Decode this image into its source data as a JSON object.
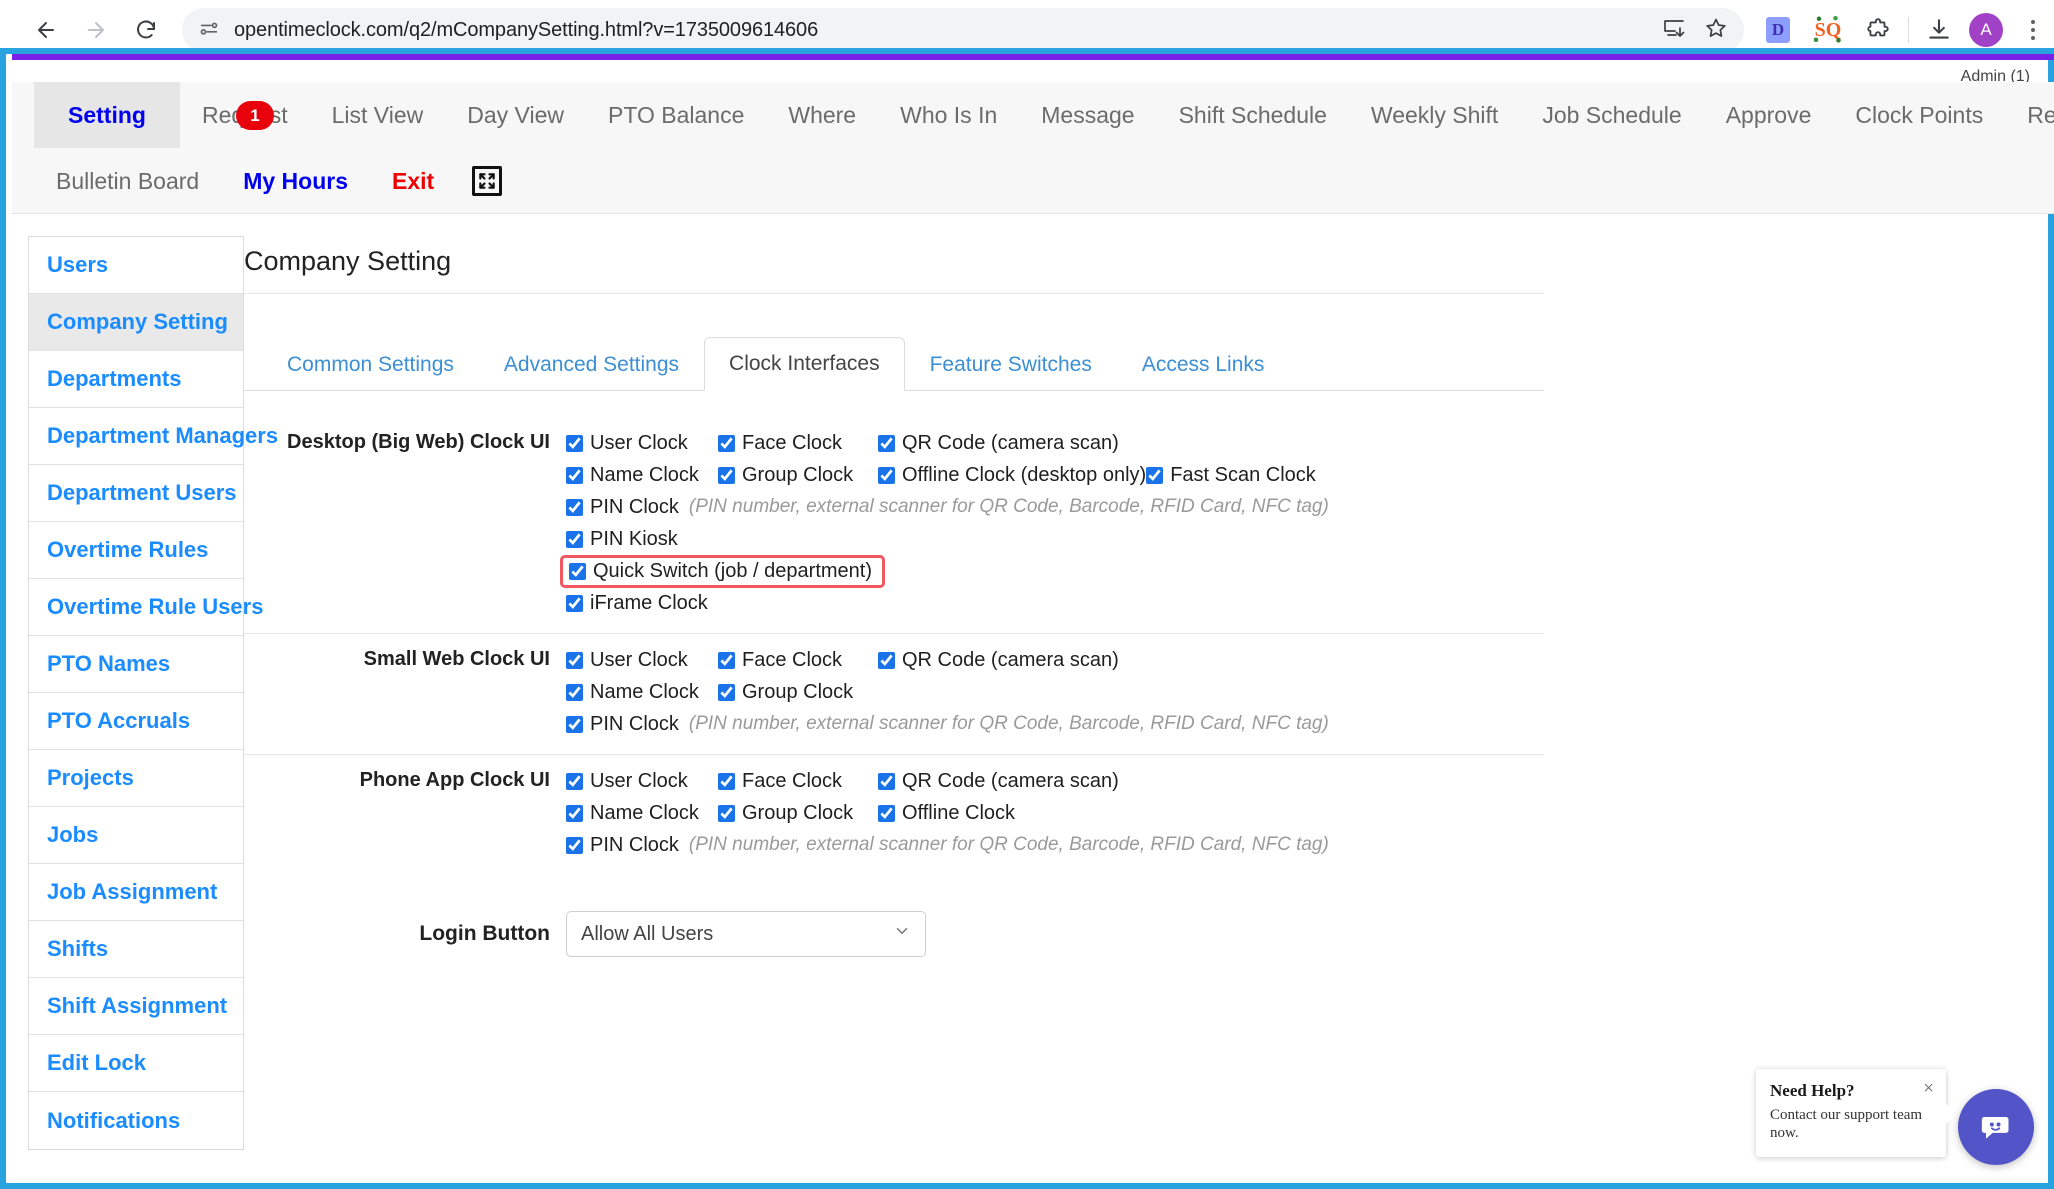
{
  "browser": {
    "url": "opentimeclock.com/q2/mCompanySetting.html?v=1735009614606",
    "back_title": "Back",
    "forward_title": "Forward",
    "reload_title": "Reload",
    "site_info_title": "View site information",
    "install_title": "Install page as app",
    "bookmark_title": "Bookmark this tab",
    "ext_d_label": "D",
    "ext_sq_label": "SQ",
    "extensions_title": "Extensions",
    "downloads_title": "Downloads",
    "avatar_initial": "A",
    "menu_title": "Customize and control Chrome"
  },
  "app": {
    "admin_label": "Admin (1)",
    "nav_row1": [
      {
        "label": "Setting",
        "state": "active"
      },
      {
        "label": "Request",
        "state": "normal",
        "badge": "1"
      },
      {
        "label": "List View",
        "state": "normal"
      },
      {
        "label": "Day View",
        "state": "normal"
      },
      {
        "label": "PTO Balance",
        "state": "normal"
      },
      {
        "label": "Where",
        "state": "normal"
      },
      {
        "label": "Who Is In",
        "state": "normal"
      },
      {
        "label": "Message",
        "state": "normal"
      },
      {
        "label": "Shift Schedule",
        "state": "normal"
      },
      {
        "label": "Weekly Shift",
        "state": "normal"
      },
      {
        "label": "Job Schedule",
        "state": "normal"
      },
      {
        "label": "Approve",
        "state": "normal"
      },
      {
        "label": "Clock Points",
        "state": "normal"
      },
      {
        "label": "Reports",
        "state": "normal"
      }
    ],
    "nav_row2": [
      {
        "label": "Bulletin Board",
        "state": "normal"
      },
      {
        "label": "My Hours",
        "state": "blue"
      },
      {
        "label": "Exit",
        "state": "red"
      }
    ],
    "expand_icon": "fullscreen-icon"
  },
  "sidebar": {
    "items": [
      {
        "label": "Users",
        "active": false
      },
      {
        "label": "Company Setting",
        "active": true
      },
      {
        "label": "Departments",
        "active": false
      },
      {
        "label": "Department Managers",
        "active": false
      },
      {
        "label": "Department Users",
        "active": false
      },
      {
        "label": "Overtime Rules",
        "active": false
      },
      {
        "label": "Overtime Rule Users",
        "active": false
      },
      {
        "label": "PTO Names",
        "active": false
      },
      {
        "label": "PTO Accruals",
        "active": false
      },
      {
        "label": "Projects",
        "active": false
      },
      {
        "label": "Jobs",
        "active": false
      },
      {
        "label": "Job Assignment",
        "active": false
      },
      {
        "label": "Shifts",
        "active": false
      },
      {
        "label": "Shift Assignment",
        "active": false
      },
      {
        "label": "Edit Lock",
        "active": false
      },
      {
        "label": "Notifications",
        "active": false
      }
    ]
  },
  "main": {
    "page_title": "Company Setting",
    "tabs": [
      {
        "label": "Common Settings",
        "active": false
      },
      {
        "label": "Advanced Settings",
        "active": false
      },
      {
        "label": "Clock Interfaces",
        "active": true
      },
      {
        "label": "Feature Switches",
        "active": false
      },
      {
        "label": "Access Links",
        "active": false
      }
    ],
    "pin_hint": "(PIN number, external scanner for QR Code, Barcode, RFID Card, NFC tag)",
    "sections": [
      {
        "label": "Desktop (Big Web) Clock UI",
        "rows": [
          [
            {
              "label": "User Clock",
              "checked": true
            },
            {
              "label": "Face Clock",
              "checked": true
            },
            {
              "label": "QR Code (camera scan)",
              "checked": true
            }
          ],
          [
            {
              "label": "Name Clock",
              "checked": true
            },
            {
              "label": "Group Clock",
              "checked": true
            },
            {
              "label": "Offline Clock (desktop only)",
              "checked": true
            },
            {
              "label": "Fast Scan Clock",
              "checked": true
            }
          ],
          [
            {
              "label": "PIN Clock",
              "checked": true,
              "hint": true
            }
          ],
          [
            {
              "label": "PIN Kiosk",
              "checked": true
            }
          ],
          [
            {
              "label": "Quick Switch (job / department)",
              "checked": true,
              "highlight": true
            }
          ],
          [
            {
              "label": "iFrame Clock",
              "checked": true
            }
          ]
        ]
      },
      {
        "label": "Small Web Clock UI",
        "rows": [
          [
            {
              "label": "User Clock",
              "checked": true
            },
            {
              "label": "Face Clock",
              "checked": true
            },
            {
              "label": "QR Code (camera scan)",
              "checked": true
            }
          ],
          [
            {
              "label": "Name Clock",
              "checked": true
            },
            {
              "label": "Group Clock",
              "checked": true
            }
          ],
          [
            {
              "label": "PIN Clock",
              "checked": true,
              "hint": true
            }
          ]
        ]
      },
      {
        "label": "Phone App Clock UI",
        "rows": [
          [
            {
              "label": "User Clock",
              "checked": true
            },
            {
              "label": "Face Clock",
              "checked": true
            },
            {
              "label": "QR Code (camera scan)",
              "checked": true
            }
          ],
          [
            {
              "label": "Name Clock",
              "checked": true
            },
            {
              "label": "Group Clock",
              "checked": true
            },
            {
              "label": "Offline Clock",
              "checked": true
            }
          ],
          [
            {
              "label": "PIN Clock",
              "checked": true,
              "hint": true
            }
          ]
        ]
      }
    ],
    "login_button_label": "Login Button",
    "login_button_value": "Allow All Users"
  },
  "chat": {
    "title": "Need Help?",
    "subtitle": "Contact our support team now.",
    "close_label": "×"
  },
  "colors": {
    "accent_blue": "#1a8cff",
    "link_blue": "#3c8fd4",
    "badge_red": "#e8000d",
    "highlight_red": "#f0575f",
    "viewport_border": "#29a3e0",
    "purple_line": "#7a21e8",
    "chat_purple": "#5254c7"
  }
}
